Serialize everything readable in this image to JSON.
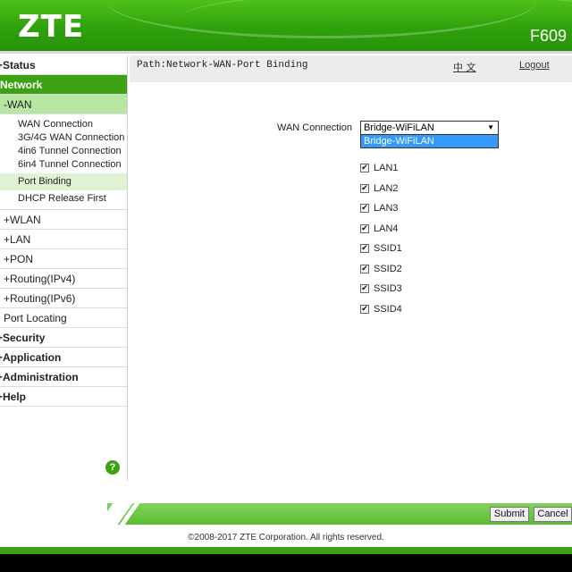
{
  "header": {
    "logo": "ZTE",
    "model": "F609"
  },
  "path": {
    "text": "Path:Network-WAN-Port Binding",
    "language": "中 文",
    "logout": "Logout"
  },
  "sidebar": {
    "status": "+Status",
    "network": "-Network",
    "wan": "-WAN",
    "wan_items": [
      "WAN Connection",
      "3G/4G WAN Connection",
      "4in6 Tunnel Connection",
      "6in4 Tunnel Connection",
      "Port Binding",
      "DHCP Release First"
    ],
    "network_items": [
      "+WLAN",
      "+LAN",
      "+PON",
      "+Routing(IPv4)",
      "+Routing(IPv6)",
      "Port Locating"
    ],
    "security": "+Security",
    "application": "+Application",
    "administration": "+Administration",
    "help": "+Help",
    "help_icon": "?"
  },
  "form": {
    "wan_label": "WAN Connection",
    "wan_value": "Bridge-WiFiLAN",
    "wan_option": "Bridge-WiFiLAN",
    "ports": [
      "LAN1",
      "LAN2",
      "LAN3",
      "LAN4",
      "SSID1",
      "SSID2",
      "SSID3",
      "SSID4"
    ],
    "checked": [
      true,
      true,
      true,
      true,
      true,
      true,
      true,
      true
    ]
  },
  "buttons": {
    "submit": "Submit",
    "cancel": "Cancel"
  },
  "footer": "©2008-2017 ZTE Corporation. All rights reserved.",
  "colors": {
    "brand_green": "#3ca214",
    "select_blue": "#3399ff"
  }
}
